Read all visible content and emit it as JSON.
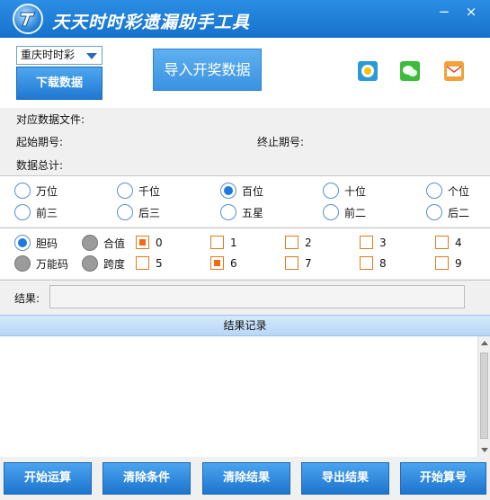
{
  "window": {
    "title": "天天时时彩遗漏助手工具",
    "minimize_glyph": "−",
    "close_glyph": "×"
  },
  "top": {
    "lottery_select": {
      "value": "重庆时时彩"
    },
    "download_label": "下载数据",
    "import_label": "导入开奖数据",
    "share_icons": [
      "qq-space-icon",
      "wechat-icon",
      "mail-icon"
    ]
  },
  "info": {
    "data_file_label": "对应数据文件:",
    "start_period_label": "起始期号:",
    "end_period_label": "终止期号:",
    "total_label": "数据总计:"
  },
  "positions": {
    "row1": [
      {
        "label": "万位",
        "checked": false
      },
      {
        "label": "千位",
        "checked": false
      },
      {
        "label": "百位",
        "checked": true
      },
      {
        "label": "十位",
        "checked": false
      },
      {
        "label": "个位",
        "checked": false
      }
    ],
    "row2": [
      {
        "label": "前三",
        "checked": false
      },
      {
        "label": "后三",
        "checked": false
      },
      {
        "label": "五星",
        "checked": false
      },
      {
        "label": "前二",
        "checked": false
      },
      {
        "label": "后二",
        "checked": false
      }
    ]
  },
  "modes": [
    {
      "label": "胆码",
      "checked": true
    },
    {
      "label": "合值",
      "checked": false
    },
    {
      "label": "万能码",
      "checked": false
    },
    {
      "label": "跨度",
      "checked": false
    }
  ],
  "digits": [
    {
      "label": "0",
      "checked": true
    },
    {
      "label": "1",
      "checked": false
    },
    {
      "label": "2",
      "checked": false
    },
    {
      "label": "3",
      "checked": false
    },
    {
      "label": "4",
      "checked": false
    },
    {
      "label": "5",
      "checked": false
    },
    {
      "label": "6",
      "checked": true
    },
    {
      "label": "7",
      "checked": false
    },
    {
      "label": "8",
      "checked": false
    },
    {
      "label": "9",
      "checked": false
    }
  ],
  "result": {
    "label": "结果:",
    "value": ""
  },
  "records": {
    "header": "结果记录"
  },
  "actions": [
    "开始运算",
    "清除条件",
    "清除结果",
    "导出结果",
    "开始算号"
  ],
  "colors": {
    "title_bar": "#1f7fd9",
    "button_blue": "#2d86db",
    "check_orange": "#f26a12"
  }
}
